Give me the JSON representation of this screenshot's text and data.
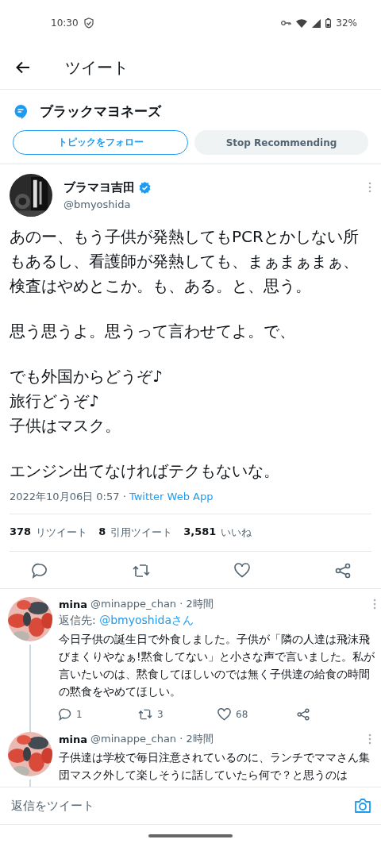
{
  "status_bar": {
    "time": "10:30",
    "battery": "32%"
  },
  "header": {
    "title": "ツイート"
  },
  "topic": {
    "name": "ブラックマヨネーズ",
    "follow_button": "トピックをフォロー",
    "stop_button": "Stop Recommending"
  },
  "tweet": {
    "name": "ブラマヨ吉田",
    "verified": true,
    "handle": "@bmyoshida",
    "paragraphs": [
      "あのー、もう子供が発熱してもPCRとかしない所もあるし、看護師が発熱しても、まぁまぁまぁ、検査はやめとこか。も、ある。と、思う。",
      "思う思うよ。思うって言わせてよ。で、",
      "でも外国からどうぞ♪\n旅行どうぞ♪\n子供はマスク。",
      "エンジン出てなければテクもないな。"
    ],
    "date": "2022年10月06日 0:57 · ",
    "source": "Twitter Web App",
    "stats": [
      {
        "count": "378",
        "label": "リツイート"
      },
      {
        "count": "8",
        "label": "引用ツイート"
      },
      {
        "count": "3,581",
        "label": "いいね"
      }
    ]
  },
  "replies": [
    {
      "name": "mina",
      "handle": "@minappe_chan · 2時間",
      "reply_to_label": "返信先: ",
      "reply_to": "@bmyoshidaさん",
      "text": "今日子供の誕生日で外食しました。子供が「隣の人達は飛沫飛びまくりやなぁ!黙食してない」と小さな声で言いました。私が言いたいのは、黙食してほしいのでは無く子供達の給食の時間の黙食をやめてほしい。",
      "replies": "1",
      "retweets": "3",
      "likes": "68"
    },
    {
      "name": "mina",
      "handle": "@minappe_chan · 2時間",
      "text": "子供達は学校で毎日注意されているのに、ランチでママさん集団マスク外して楽しそうに話していたら何で？と思うのは"
    }
  ],
  "composer": {
    "placeholder": "返信をツイート"
  }
}
